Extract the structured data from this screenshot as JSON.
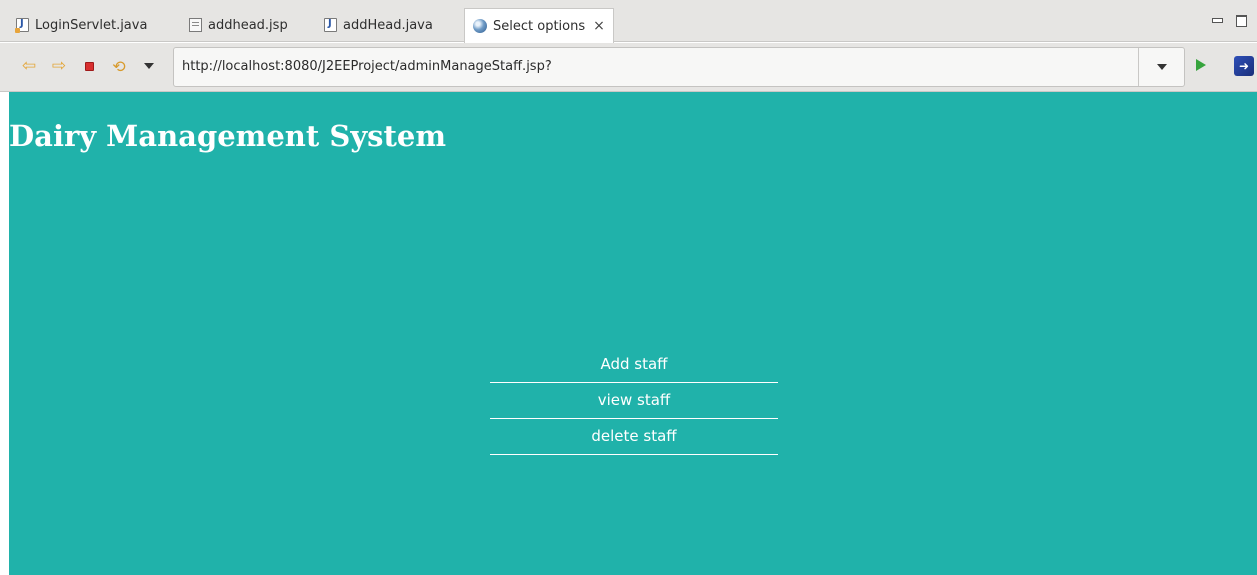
{
  "tabs": [
    {
      "label": "LoginServlet.java",
      "icon": "java-file-warning-icon"
    },
    {
      "label": "addhead.jsp",
      "icon": "jsp-file-icon"
    },
    {
      "label": "addHead.java",
      "icon": "java-file-icon"
    },
    {
      "label": "Select options",
      "icon": "globe-icon",
      "active": true,
      "close": "×"
    }
  ],
  "toolbar": {
    "url": "http://localhost:8080/J2EEProject/adminManageStaff.jsp?",
    "back_icon": "⇦",
    "forward_icon": "⇨",
    "refresh_icon": "⟲",
    "external_icon": "➜"
  },
  "page": {
    "title": "Dairy Management System",
    "background": "#20b2aa",
    "menu": [
      {
        "label": "Add staff"
      },
      {
        "label": "view staff"
      },
      {
        "label": "delete staff"
      }
    ]
  }
}
